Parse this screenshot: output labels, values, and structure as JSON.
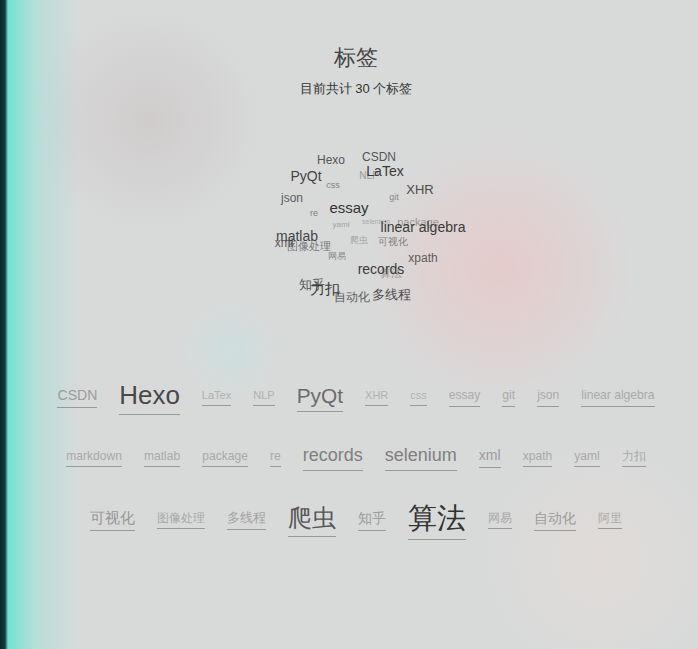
{
  "page": {
    "title": "标签",
    "subtitle": "目前共计 30 个标签"
  },
  "cloud": [
    "Hexo",
    "CSDN",
    "PyQt",
    "NLP",
    "LaTex",
    "css",
    "XHR",
    "json",
    "git",
    "re",
    "essay",
    "yaml",
    "selenium",
    "package",
    "linear algebra",
    "matlab",
    "爬虫",
    "可视化",
    "xml",
    "图像处理",
    "网易",
    "xpath",
    "records",
    "算法",
    "知乎",
    "力扣",
    "自动化",
    "多线程"
  ],
  "tags": [
    {
      "label": "CSDN",
      "level": 0.17
    },
    {
      "label": "Hexo",
      "level": 0.83
    },
    {
      "label": "LaTex",
      "level": 0.0
    },
    {
      "label": "NLP",
      "level": 0.0
    },
    {
      "label": "PyQt",
      "level": 0.55
    },
    {
      "label": "XHR",
      "level": 0.0
    },
    {
      "label": "css",
      "level": 0.0
    },
    {
      "label": "essay",
      "level": 0.06
    },
    {
      "label": "git",
      "level": 0.06
    },
    {
      "label": "json",
      "level": 0.06
    },
    {
      "label": "linear algebra",
      "level": 0.06
    },
    {
      "label": "markdown",
      "level": 0.06
    },
    {
      "label": "matlab",
      "level": 0.06
    },
    {
      "label": "package",
      "level": 0.06
    },
    {
      "label": "re",
      "level": 0.06
    },
    {
      "label": "records",
      "level": 0.39
    },
    {
      "label": "selenium",
      "level": 0.39
    },
    {
      "label": "xml",
      "level": 0.17
    },
    {
      "label": "xpath",
      "level": 0.06
    },
    {
      "label": "yaml",
      "level": 0.06
    },
    {
      "label": "力扣",
      "level": 0.06
    },
    {
      "label": "可视化",
      "level": 0.22
    },
    {
      "label": "图像处理",
      "level": 0.06
    },
    {
      "label": "多线程",
      "level": 0.11
    },
    {
      "label": "爬虫",
      "level": 0.72
    },
    {
      "label": "知乎",
      "level": 0.17
    },
    {
      "label": "算法",
      "level": 1.0
    },
    {
      "label": "网易",
      "level": 0.06
    },
    {
      "label": "自动化",
      "level": 0.17
    },
    {
      "label": "阿里",
      "level": 0.06
    }
  ]
}
